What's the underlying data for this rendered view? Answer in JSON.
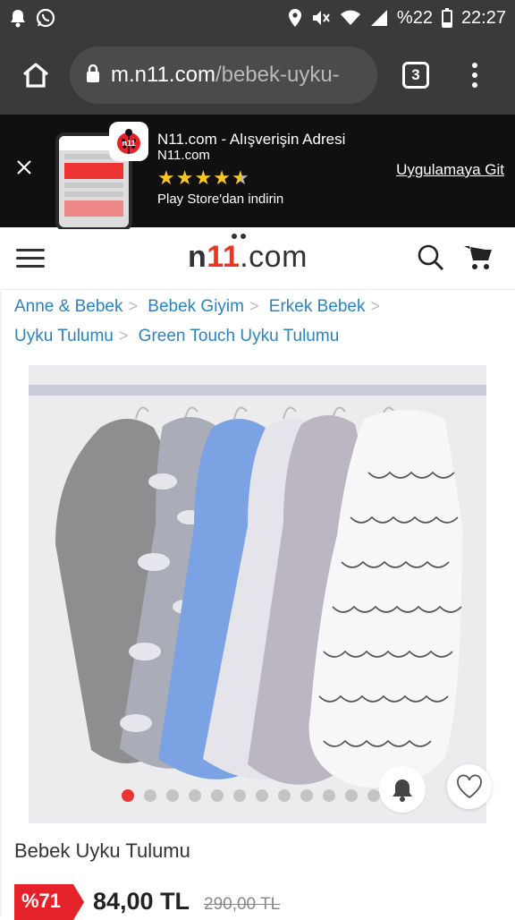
{
  "statusbar": {
    "battery_pct": "%22",
    "time": "22:27"
  },
  "browser": {
    "url_host": "m.n11.com",
    "url_path": "/bebek-uyku-",
    "tab_count": "3"
  },
  "app_banner": {
    "title": "N11.com - Alışverişin Adresi",
    "subtitle": "N11.com",
    "store_text": "Play Store'dan indirin",
    "cta": "Uygulamaya Git",
    "rating": 4.5
  },
  "header": {
    "logo_prefix": "n",
    "logo_11": "11",
    "logo_suffix": ".com"
  },
  "breadcrumb": [
    "Anne & Bebek",
    "Bebek Giyim",
    "Erkek Bebek",
    "Uyku Tulumu",
    "Green Touch Uyku Tulumu"
  ],
  "gallery": {
    "total_images": 12,
    "active_index": 0
  },
  "product": {
    "title": "Bebek Uyku Tulumu",
    "discount": "%71",
    "price": "84,00 TL",
    "old_price": "290,00 TL"
  },
  "colors": {
    "brand_red": "#e52229",
    "link_blue": "#2a84c2"
  }
}
